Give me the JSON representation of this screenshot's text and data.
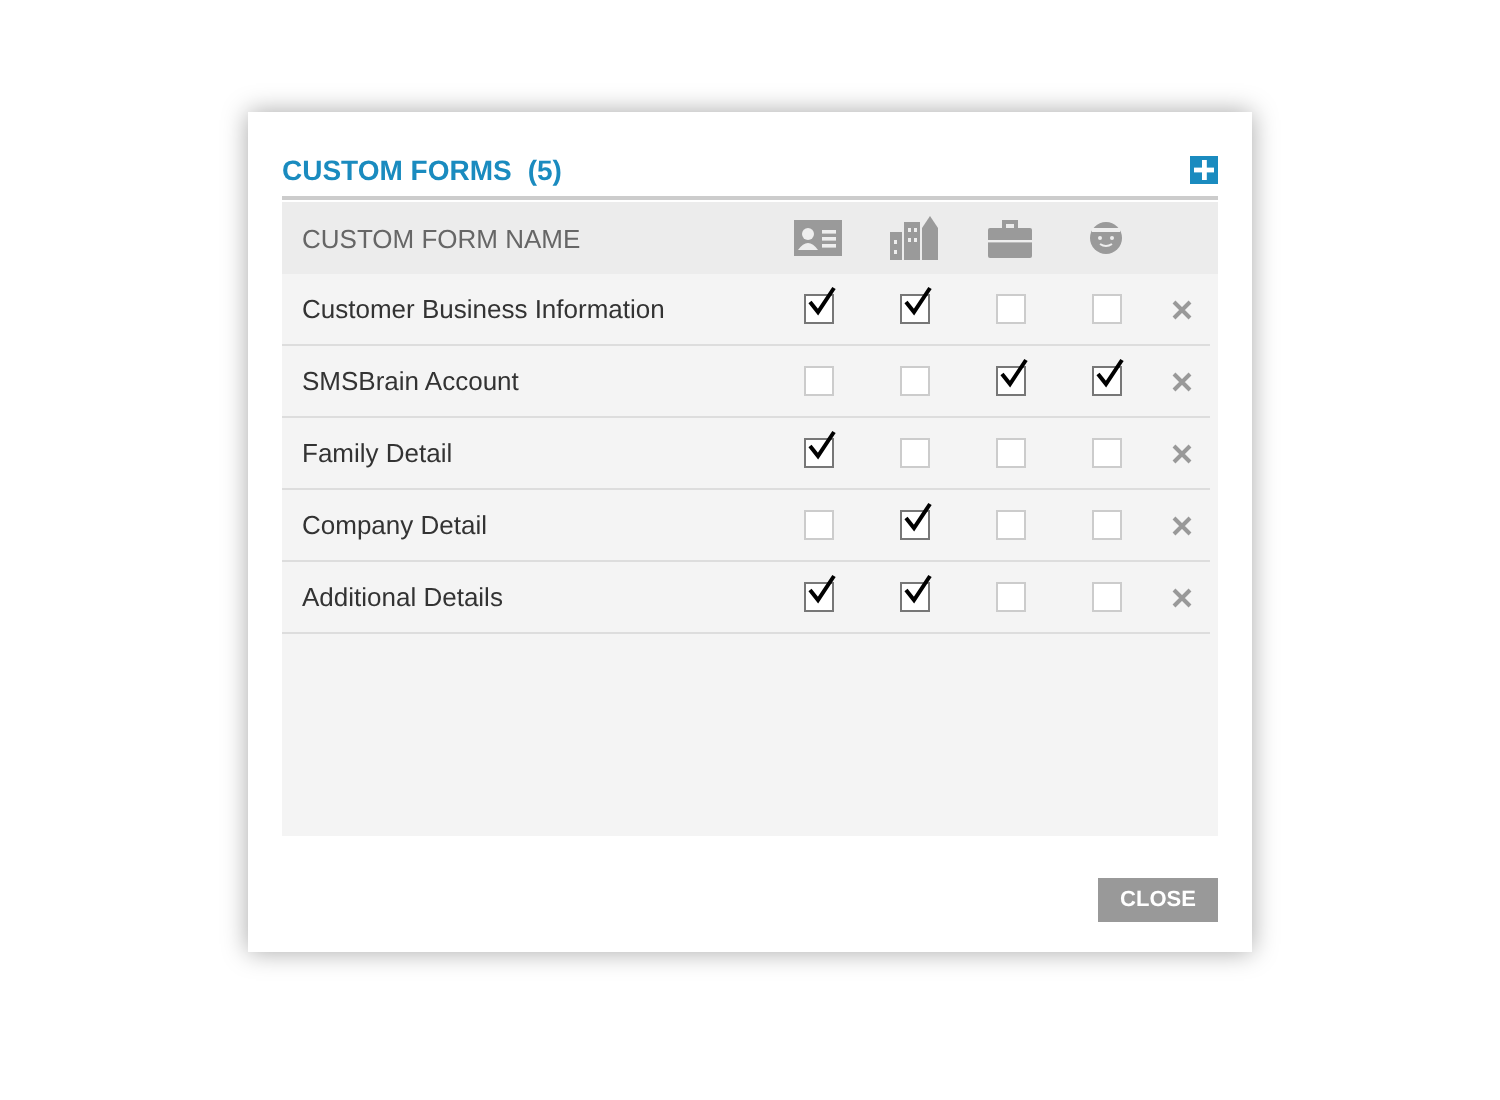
{
  "dialog": {
    "title": "CUSTOM FORMS",
    "count": "(5)"
  },
  "table": {
    "name_column": "CUSTOM FORM NAME",
    "rows": [
      {
        "name": "Customer Business Information",
        "checks": [
          true,
          true,
          false,
          false
        ]
      },
      {
        "name": "SMSBrain Account",
        "checks": [
          false,
          false,
          true,
          true
        ]
      },
      {
        "name": "Family Detail",
        "checks": [
          true,
          false,
          false,
          false
        ]
      },
      {
        "name": "Company Detail",
        "checks": [
          false,
          true,
          false,
          false
        ]
      },
      {
        "name": "Additional Details",
        "checks": [
          true,
          true,
          false,
          false
        ]
      }
    ]
  },
  "buttons": [
    "CLOSE"
  ]
}
